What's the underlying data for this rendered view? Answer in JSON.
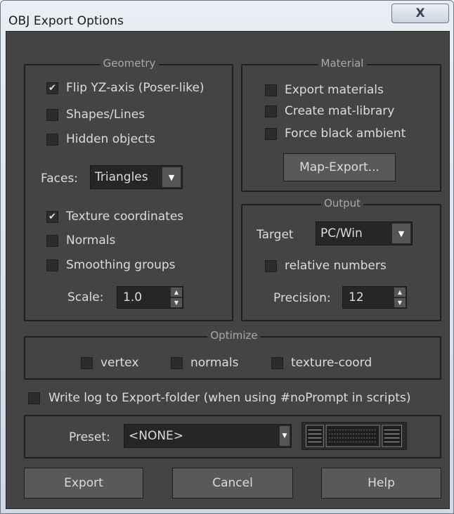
{
  "window": {
    "title": "OBJ Export Options",
    "close_glyph": "X"
  },
  "geometry": {
    "title": "Geometry",
    "flip_yz": {
      "label": "Flip YZ-axis (Poser-like)",
      "checked": true
    },
    "shapes_lines": {
      "label": "Shapes/Lines",
      "checked": false
    },
    "hidden_objects": {
      "label": "Hidden objects",
      "checked": false
    },
    "faces_label": "Faces:",
    "faces_value": "Triangles",
    "texture_coordinates": {
      "label": "Texture coordinates",
      "checked": true
    },
    "normals": {
      "label": "Normals",
      "checked": false
    },
    "smoothing_groups": {
      "label": "Smoothing groups",
      "checked": false
    },
    "scale_label": "Scale:",
    "scale_value": "1.0"
  },
  "material": {
    "title": "Material",
    "export_materials": {
      "label": "Export materials",
      "checked": false
    },
    "create_mat_library": {
      "label": "Create mat-library",
      "checked": false
    },
    "force_black_ambient": {
      "label": "Force black ambient",
      "checked": false
    },
    "map_export_label": "Map-Export..."
  },
  "output": {
    "title": "Output",
    "target_label": "Target",
    "target_value": "PC/Win",
    "relative_numbers": {
      "label": "relative numbers",
      "checked": false
    },
    "precision_label": "Precision:",
    "precision_value": "12"
  },
  "optimize": {
    "title": "Optimize",
    "vertex": {
      "label": "vertex",
      "checked": false
    },
    "normals": {
      "label": "normals",
      "checked": false
    },
    "texture_coord": {
      "label": "texture-coord",
      "checked": false
    }
  },
  "write_log": {
    "label": "Write log to Export-folder (when using #noPrompt in scripts)",
    "checked": false
  },
  "preset": {
    "label": "Preset:",
    "value": "<NONE>",
    "icon": "preset-manager-icon"
  },
  "buttons": {
    "export": "Export",
    "cancel": "Cancel",
    "help": "Help"
  },
  "colors": {
    "panel": "#444444",
    "text": "#dcdcdc",
    "group_title": "#a8a8a8",
    "field": "#262626"
  }
}
